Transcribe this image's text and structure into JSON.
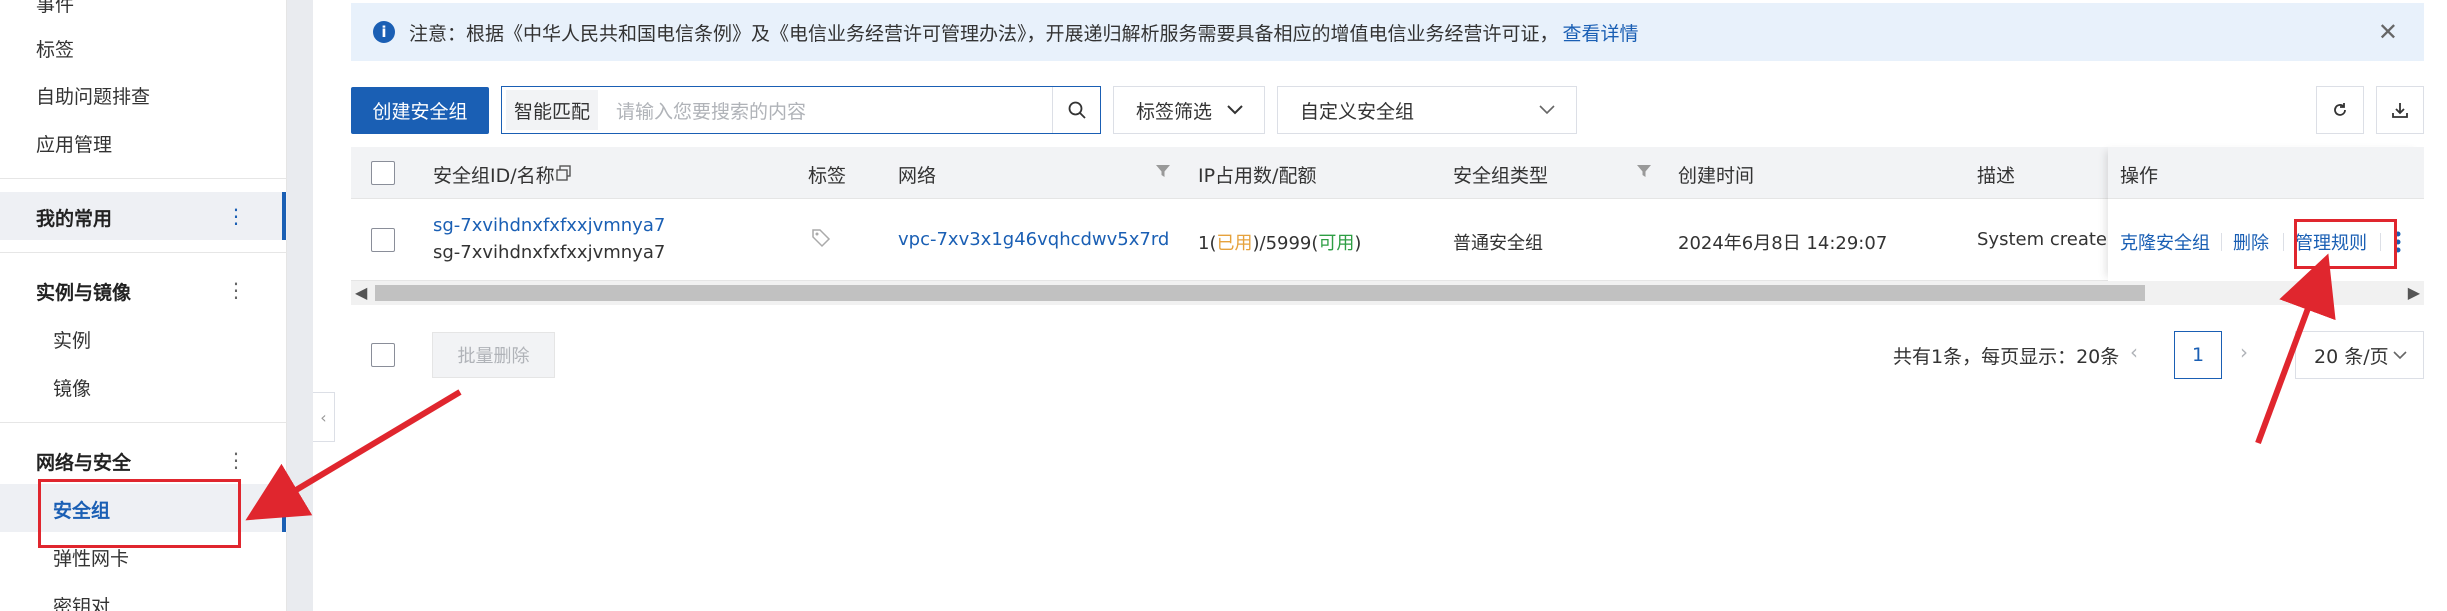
{
  "sidebar": {
    "items_top": [
      "事件",
      "标签",
      "自助问题排查",
      "应用管理"
    ],
    "groups": [
      {
        "label": "我的常用",
        "active": true
      },
      {
        "label": "实例与镜像",
        "children": [
          "实例",
          "镜像"
        ]
      },
      {
        "label": "网络与安全",
        "children": [
          "安全组",
          "弹性网卡",
          "密钥对"
        ],
        "active_child": "安全组"
      }
    ],
    "more_icon": "⋮",
    "collapse_icon": "‹"
  },
  "notice": {
    "text": "注意：根据《中华人民共和国电信条例》及《电信业务经营许可管理办法》，开展递归解析服务需要具备相应的增值电信业务经营许可证，",
    "link": "查看详情",
    "info_icon": "i",
    "close_icon": "✕"
  },
  "toolbar": {
    "create_button": "创建安全组",
    "search_mode": "智能匹配",
    "search_placeholder": "请输入您要搜索的内容",
    "tag_filter": "标签筛选",
    "group_select": "自定义安全组"
  },
  "table": {
    "columns": [
      "安全组ID/名称",
      "标签",
      "网络",
      "IP占用数/配额",
      "安全组类型",
      "创建时间",
      "描述",
      "操作"
    ],
    "rows": [
      {
        "id": "sg-7xvihdnxfxfxxjvmnya7",
        "name": "sg-7xvihdnxfxfxxjvmnya7",
        "network": "vpc-7xv3x1g46vqhcdwv5x7rd",
        "ip_used": "1",
        "ip_used_label": "已用",
        "ip_quota": "/5999",
        "ip_avail_label": "可用",
        "type": "普通安全组",
        "created": "2024年6月8日 14:29:07",
        "description": "System created s",
        "actions": [
          "克隆安全组",
          "删除",
          "管理规则"
        ]
      }
    ]
  },
  "footer": {
    "batch_delete": "批量删除",
    "total": "共有1条，每页显示：20条",
    "current_page": "1",
    "page_size": "20 条/页",
    "prev_icon": "‹",
    "next_icon": "›"
  },
  "colors": {
    "primary": "#1a5fb4",
    "warning": "#e6a23c",
    "success": "#2e9e44",
    "annotation": "#e0262e"
  }
}
